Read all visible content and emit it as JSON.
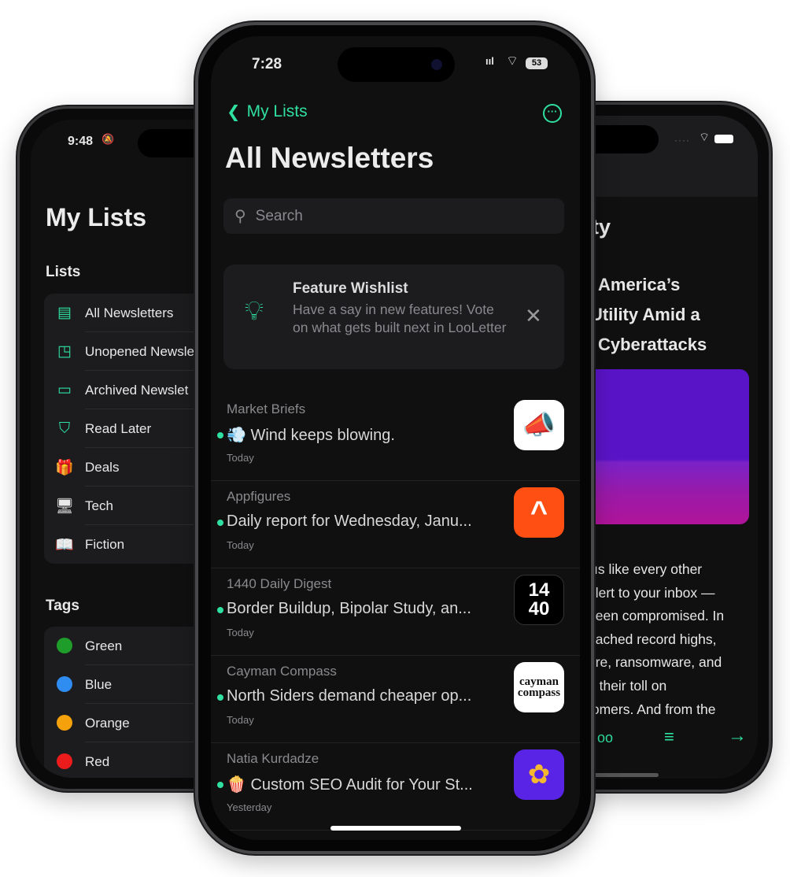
{
  "accent": "#2fe0a0",
  "left_phone": {
    "time": "9:48",
    "title": "My Lists",
    "lists_header": "Lists",
    "lists": [
      {
        "label": "All Newsletters",
        "icon": "newspaper-icon"
      },
      {
        "label": "Unopened Newsle",
        "icon": "unread-badge-icon"
      },
      {
        "label": "Archived Newslet",
        "icon": "archive-icon"
      },
      {
        "label": "Read Later",
        "icon": "bookmark-icon"
      },
      {
        "label": "Deals",
        "icon": "gift-emoji",
        "glyph": "🎁"
      },
      {
        "label": "Tech",
        "icon": "desktop-emoji",
        "glyph": "🖥"
      },
      {
        "label": "Fiction",
        "icon": "book-emoji",
        "glyph": "📖"
      }
    ],
    "tags_header": "Tags",
    "tags": [
      {
        "label": "Green",
        "color": "#1f9d2a"
      },
      {
        "label": "Blue",
        "color": "#2f8cf0"
      },
      {
        "label": "Orange",
        "color": "#f5a10b"
      },
      {
        "label": "Red",
        "color": "#ec1c1c"
      }
    ]
  },
  "center_phone": {
    "time": "7:28",
    "battery": "53",
    "back_label": "My Lists",
    "title": "All Newsletters",
    "search_placeholder": "Search",
    "wishlist": {
      "title": "Feature Wishlist",
      "body": "Have a say in new features! Vote on what gets built next in LooLetter"
    },
    "items": [
      {
        "sender": "Market Briefs",
        "emoji": "💨",
        "title": "Wind keeps blowing.",
        "date": "Today",
        "unread": true
      },
      {
        "sender": "Appfigures",
        "emoji": "",
        "title": "Daily report for Wednesday, Janu...",
        "date": "Today",
        "unread": true
      },
      {
        "sender": "1440 Daily Digest",
        "emoji": "",
        "title": "Border Buildup, Bipolar Study, an...",
        "date": "Today",
        "unread": true,
        "logo_text": "14 40"
      },
      {
        "sender": "Cayman Compass",
        "emoji": "",
        "title": "North Siders demand cheaper op...",
        "date": "Today",
        "unread": true,
        "logo_text": "cayman compass"
      },
      {
        "sender": "Natia Kurdadze",
        "emoji": "🍿",
        "title": "Custom SEO Audit for Your St...",
        "date": "Yesterday",
        "unread": true
      }
    ]
  },
  "right_phone": {
    "title_fragment": "ty",
    "headline": [
      "America’s",
      "Utility Amid a",
      "Cyberattacks"
    ],
    "body": [
      "ıs like every other",
      "alert to your inbox —",
      "been compromised. In",
      "eached record highs,",
      "are, ransomware, and",
      "g their toll on",
      "tomers. And from the"
    ]
  }
}
